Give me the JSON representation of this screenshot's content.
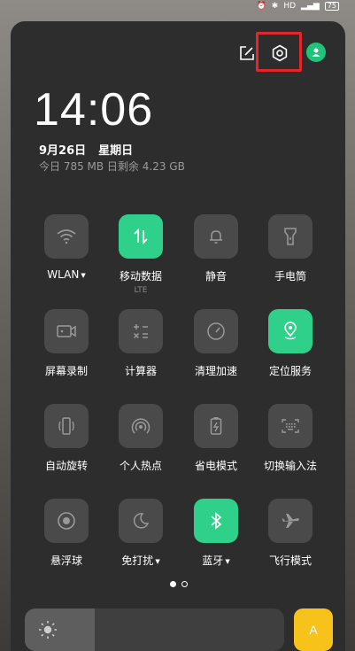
{
  "status_bar": {
    "battery": "75",
    "icons": [
      "alarm-icon",
      "bluetooth-icon",
      "hd-icon",
      "signal-icon",
      "battery-icon"
    ]
  },
  "header": {
    "icons": [
      "edit-icon",
      "settings-gear-icon",
      "user-avatar-icon"
    ],
    "accent": "#2fd08a",
    "highlight_color": "#e4262c"
  },
  "clock": {
    "time": "14:06",
    "date": "9月26日",
    "weekday": "星期日",
    "data_usage": "今日 785 MB 日剩余 4.23 GB"
  },
  "tiles": [
    {
      "label": "WLAN",
      "icon": "wifi-icon",
      "active": false,
      "has_menu": true
    },
    {
      "label": "移动数据",
      "sub": "LTE",
      "icon": "mobile-data-icon",
      "active": true
    },
    {
      "label": "静音",
      "icon": "bell-icon",
      "active": false
    },
    {
      "label": "手电筒",
      "icon": "flashlight-icon",
      "active": false
    },
    {
      "label": "屏幕录制",
      "icon": "screen-record-icon",
      "active": false
    },
    {
      "label": "计算器",
      "icon": "calculator-icon",
      "active": false
    },
    {
      "label": "清理加速",
      "icon": "speed-gauge-icon",
      "active": false
    },
    {
      "label": "定位服务",
      "icon": "location-icon",
      "active": true
    },
    {
      "label": "自动旋转",
      "icon": "auto-rotate-icon",
      "active": false
    },
    {
      "label": "个人热点",
      "icon": "hotspot-icon",
      "active": false
    },
    {
      "label": "省电模式",
      "icon": "battery-saver-icon",
      "active": false
    },
    {
      "label": "切换输入法",
      "icon": "keyboard-icon",
      "active": false
    },
    {
      "label": "悬浮球",
      "icon": "floating-ball-icon",
      "active": false
    },
    {
      "label": "免打扰",
      "icon": "moon-icon",
      "active": false,
      "has_menu": true
    },
    {
      "label": "蓝牙",
      "icon": "bluetooth-icon",
      "active": true,
      "has_menu": true
    },
    {
      "label": "飞行模式",
      "icon": "airplane-icon",
      "active": false
    }
  ],
  "pager": {
    "pages": 2,
    "current": 1
  },
  "brightness": {
    "level": 0.27,
    "auto_label": "A"
  }
}
